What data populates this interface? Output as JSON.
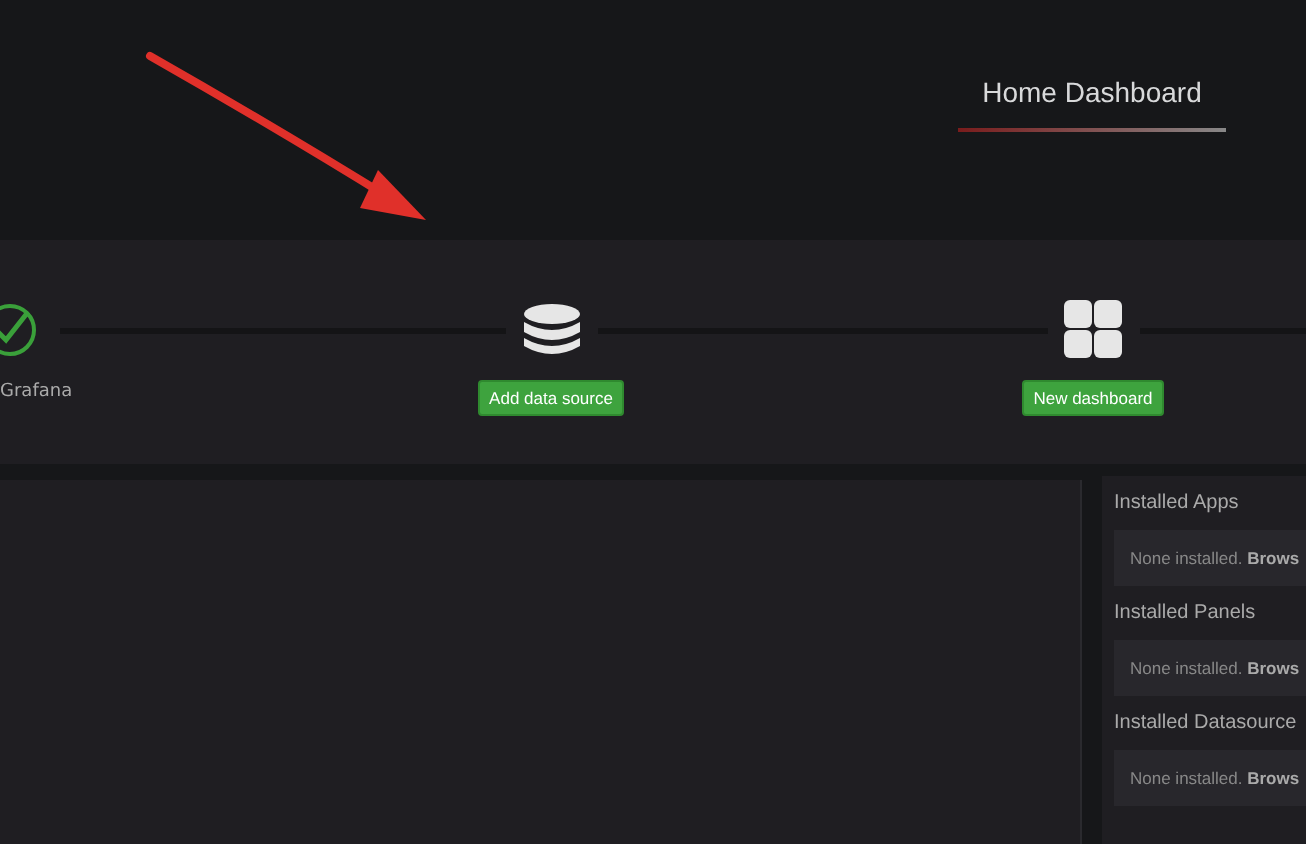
{
  "header": {
    "title": "Home Dashboard"
  },
  "steps": [
    {
      "kind": "completed",
      "label": "Grafana"
    },
    {
      "kind": "action",
      "label": "Add data source"
    },
    {
      "kind": "action",
      "label": "New dashboard"
    }
  ],
  "sidebar": {
    "sections": [
      {
        "title": "Installed Apps",
        "message": "None installed. **Brows**"
      },
      {
        "title": "Installed Panels",
        "message": "None installed. **Brows**"
      },
      {
        "title": "Installed Datasource",
        "message": "None installed. **Brows**"
      }
    ]
  }
}
